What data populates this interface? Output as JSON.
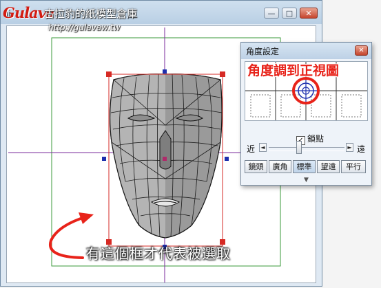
{
  "watermark": {
    "logo": "Gulava",
    "line1": "古拉豹的紙模型倉庫",
    "line2": "http://gulavaw.tw"
  },
  "window": {
    "title_fragment": "ii",
    "controls": {
      "minimize": "—",
      "maximize": "□",
      "close": "✕"
    }
  },
  "angle_panel": {
    "title": "角度設定",
    "close": "✕",
    "heading_annotation": "角度調到正視圖",
    "lock_checkbox": {
      "checked": true,
      "mark": "✓",
      "label": "鎖點"
    },
    "slider": {
      "near_label": "近",
      "far_label": "遠",
      "left_arrow": "◄",
      "right_arrow": "►",
      "value": 0.4
    },
    "modes": [
      "鏡頭",
      "廣角",
      "標準",
      "望遠",
      "平行"
    ],
    "grip": "▼"
  },
  "annotation_text": "有這個框才代表被選取",
  "colors": {
    "selection_box": "#d62a24",
    "axis_line": "#7a2a9b",
    "handle": "#1d2fae",
    "annotation_red": "#e8231a",
    "model_grey": "#a3a3a3"
  }
}
